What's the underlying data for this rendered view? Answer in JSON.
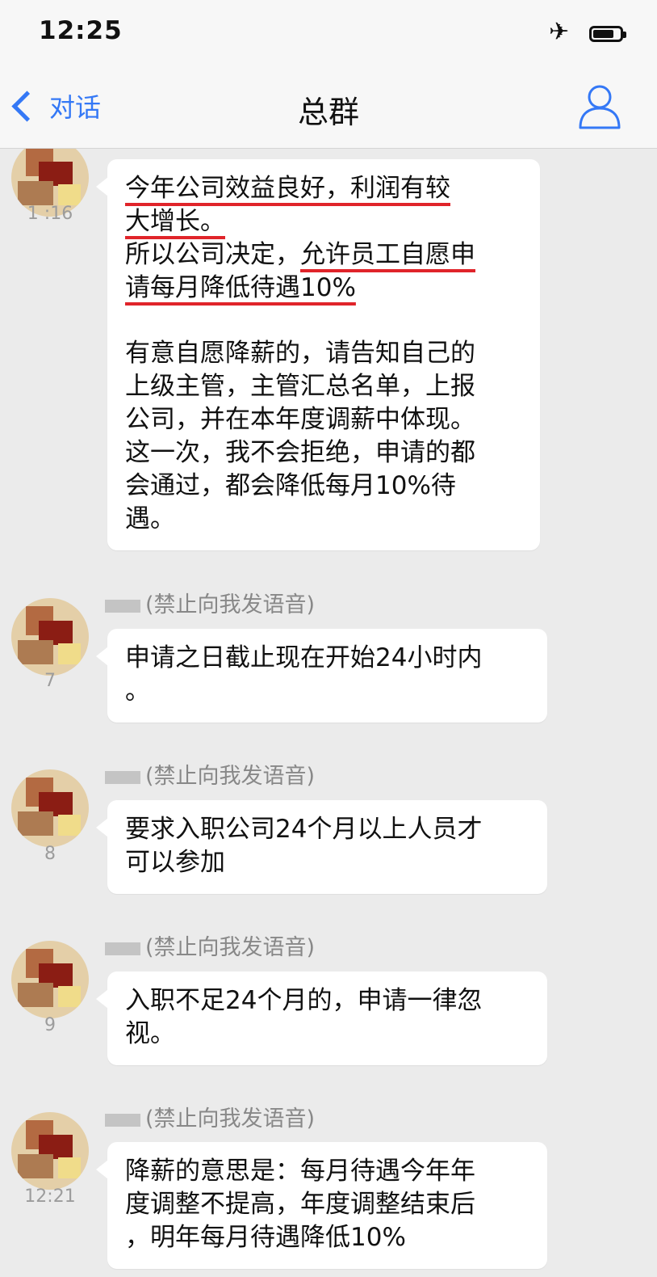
{
  "status_bar": {
    "time": "12:25",
    "airplane_mode": true,
    "battery_level": 0.7
  },
  "nav": {
    "back_label": "对话",
    "title": "总群"
  },
  "messages": [
    {
      "sender": "",
      "timestamp": "1 :16",
      "paragraphs": [
        {
          "lines": [
            {
              "segments": [
                {
                  "text": "今年公司效益良好，利润有较",
                  "highlight": true
                }
              ]
            },
            {
              "segments": [
                {
                  "text": "大增长。",
                  "highlight": true
                }
              ]
            },
            {
              "segments": [
                {
                  "text": "所以公司决定，",
                  "highlight": false
                },
                {
                  "text": "允许员工自愿申",
                  "highlight": true
                }
              ]
            },
            {
              "segments": [
                {
                  "text": "请每月降低待遇10%",
                  "highlight": true
                }
              ]
            }
          ]
        },
        {
          "lines": [
            {
              "segments": [
                {
                  "text": "有意自愿降薪的，请告知自己的",
                  "highlight": false
                }
              ]
            },
            {
              "segments": [
                {
                  "text": "上级主管，主管汇总名单，上报",
                  "highlight": false
                }
              ]
            },
            {
              "segments": [
                {
                  "text": "公司，并在本年度调薪中体现。",
                  "highlight": false
                }
              ]
            },
            {
              "segments": [
                {
                  "text": "这一次，我不会拒绝，申请的都",
                  "highlight": false
                }
              ]
            },
            {
              "segments": [
                {
                  "text": "会通过，都会降低每月10%待",
                  "highlight": false
                }
              ]
            },
            {
              "segments": [
                {
                  "text": "遇。",
                  "highlight": false
                }
              ]
            }
          ]
        }
      ]
    },
    {
      "sender": "(禁止向我发语音)",
      "timestamp": "7",
      "paragraphs": [
        {
          "lines": [
            {
              "segments": [
                {
                  "text": "申请之日截止现在开始24小时内",
                  "highlight": false
                }
              ]
            },
            {
              "segments": [
                {
                  "text": "。",
                  "highlight": false
                }
              ]
            }
          ]
        }
      ]
    },
    {
      "sender": "(禁止向我发语音)",
      "timestamp": "8",
      "paragraphs": [
        {
          "lines": [
            {
              "segments": [
                {
                  "text": "要求入职公司24个月以上人员才",
                  "highlight": false
                }
              ]
            },
            {
              "segments": [
                {
                  "text": "可以参加",
                  "highlight": false
                }
              ]
            }
          ]
        }
      ]
    },
    {
      "sender": "(禁止向我发语音)",
      "timestamp": "9",
      "paragraphs": [
        {
          "lines": [
            {
              "segments": [
                {
                  "text": "入职不足24个月的，申请一律忽",
                  "highlight": false
                }
              ]
            },
            {
              "segments": [
                {
                  "text": "视。",
                  "highlight": false
                }
              ]
            }
          ]
        }
      ]
    },
    {
      "sender": "(禁止向我发语音)",
      "timestamp": "12:21",
      "paragraphs": [
        {
          "lines": [
            {
              "segments": [
                {
                  "text": "降薪的意思是：每月待遇今年年",
                  "highlight": false
                }
              ]
            },
            {
              "segments": [
                {
                  "text": "度调整不提高，年度调整结束后",
                  "highlight": false
                }
              ]
            },
            {
              "segments": [
                {
                  "text": "，明年每月待遇降低10%",
                  "highlight": false
                }
              ]
            }
          ]
        }
      ]
    }
  ]
}
